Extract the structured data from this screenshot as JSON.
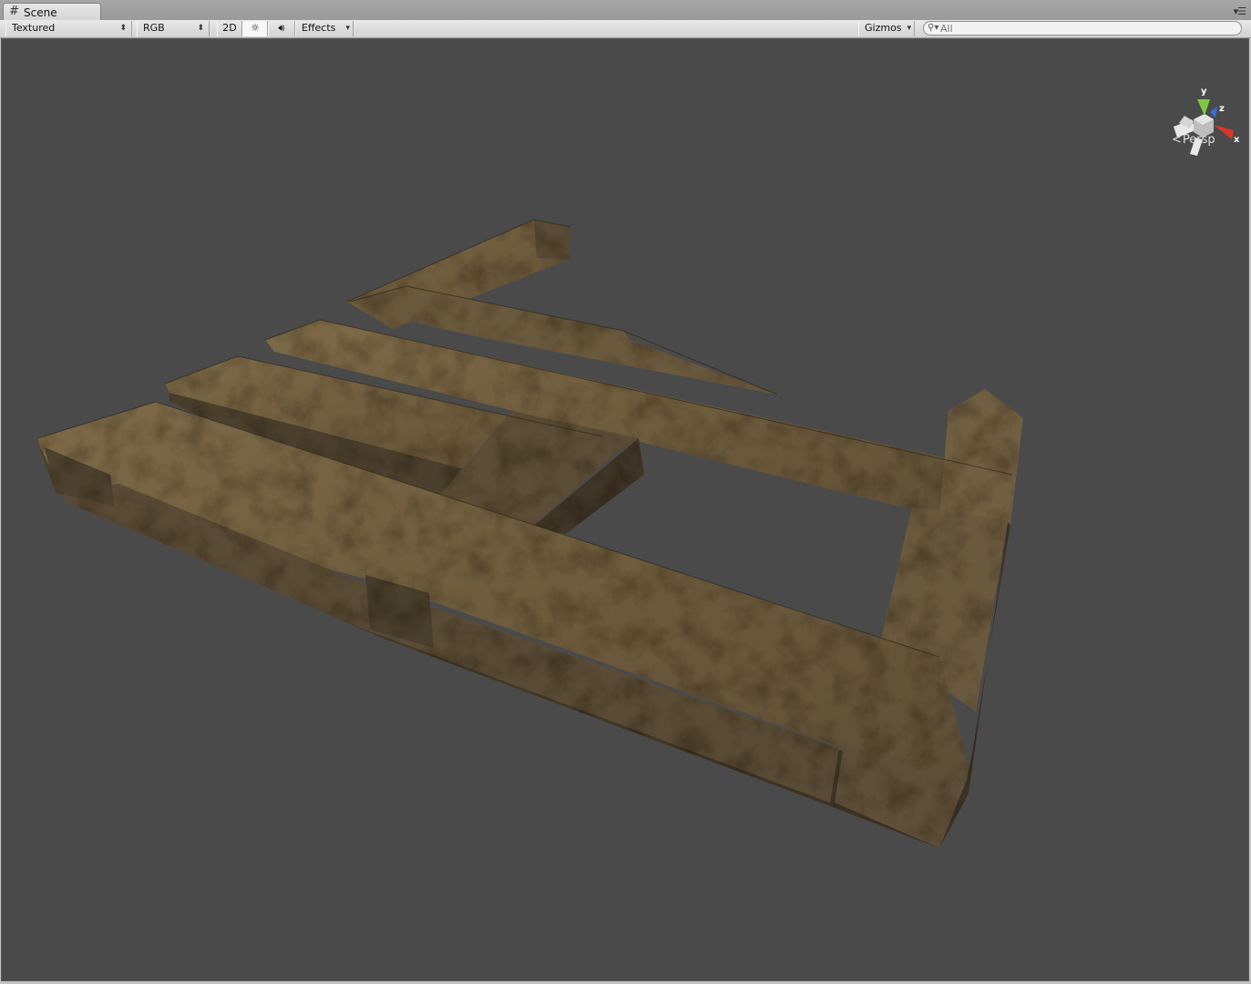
{
  "tab": {
    "icon": "scene-grid-icon",
    "label": "Scene",
    "menu_icon": "panel-menu-icon"
  },
  "toolbar": {
    "draw_mode": "Textured",
    "render_mode": "RGB",
    "mode_2d": "2D",
    "lighting_icon": "sun-icon",
    "audio_icon": "speaker-icon",
    "effects": "Effects",
    "gizmos": "Gizmos"
  },
  "search": {
    "icon": "search-icon",
    "placeholder": "All",
    "value": ""
  },
  "orientation_gizmo": {
    "axis_y": "y",
    "axis_z": "z",
    "axis_x": "x",
    "projection": "Persp",
    "colors": {
      "y": "#7ec83f",
      "z": "#3a6fe0",
      "x": "#d9362b",
      "neutral": "#e8e8e8"
    }
  },
  "viewport": {
    "background": "#4a4a4a",
    "object": "wooden-pallet-mesh"
  }
}
